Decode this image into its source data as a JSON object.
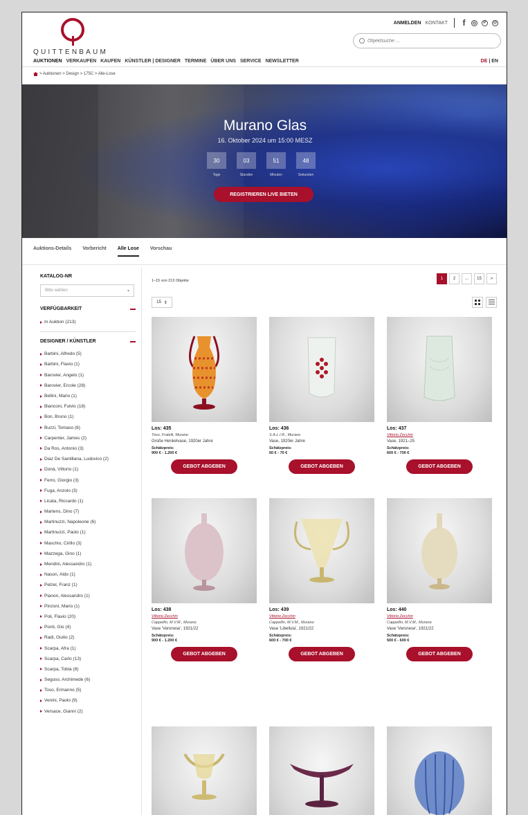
{
  "header": {
    "logo_text": "QUITTENBAUM",
    "anmelden": "ANMELDEN",
    "kontakt": "KONTAKT",
    "search_placeholder": "Objektsuche ...",
    "nav": [
      "AUKTIONEN",
      "VERKAUFEN",
      "KAUFEN",
      "KÜNSTLER | DESIGNER",
      "TERMINE",
      "ÜBER UNS",
      "SERVICE",
      "NEWSLETTER"
    ],
    "lang_de": "DE",
    "lang_sep": "|",
    "lang_en": "EN"
  },
  "breadcrumb": "> Auktionen > Design > 175C > Alle-Lose",
  "hero": {
    "title": "Murano Glas",
    "date": "16. Oktober 2024 um 15:00 MESZ",
    "countdown": [
      {
        "value": "30",
        "label": "Tage"
      },
      {
        "value": "03",
        "label": "Stunden"
      },
      {
        "value": "51",
        "label": "Minuten"
      },
      {
        "value": "48",
        "label": "Sekunden"
      }
    ],
    "register_label": "REGISTRIEREN LIVE BIETEN"
  },
  "tabs": [
    "Auktions-Details",
    "Vorbericht",
    "Alle Lose",
    "Vorschau"
  ],
  "sidebar": {
    "katalog_title": "KATALOG-NR",
    "katalog_placeholder": "Bitte wählen",
    "verf_title": "VERFÜGBARKEIT",
    "verf_items": [
      "In Auktion (213)"
    ],
    "designer_title": "DESIGNER / KÜNSTLER",
    "designers": [
      "Barbini, Alfredo (5)",
      "Barbini, Flavio (1)",
      "Barovier, Angelo (1)",
      "Barovier, Ercole (28)",
      "Bellini, Mario (1)",
      "Bianconi, Fulvio (18)",
      "Bon, Bruno (1)",
      "Buzzi, Tomaso (6)",
      "Carpenter, James (2)",
      "Da Ros, Antonio (3)",
      "Diaz De Santillana, Ludovico (2)",
      "Donà, Vittorio (1)",
      "Ferro, Giorgio (3)",
      "Fuga, Anzolo (3)",
      "Licata, Riccardo (1)",
      "Martens, Dino (7)",
      "Martinuzzi, Napoleone (6)",
      "Martinuzzi, Paolo (1)",
      "Maschio, Cirillo (3)",
      "Mazzega, Gino (1)",
      "Mendini, Alessandro (1)",
      "Nason, Aldo (1)",
      "Pelzel, Franz (1)",
      "Pianon, Alessandro (1)",
      "Pinzoni, Mario (1)",
      "Poli, Flavio (20)",
      "Ponti, Gio (4)",
      "Radi, Giulio (2)",
      "Scarpa, Afra (1)",
      "Scarpa, Carlo (13)",
      "Scarpa, Tobia (8)",
      "Seguso, Archimede (6)",
      "Toso, Ermanno (5)",
      "Venini, Paolo (9)",
      "Versace, Gianni (2)"
    ]
  },
  "listing": {
    "results": "1–15 von 213 Objekte",
    "pager": [
      "1",
      "2",
      "...",
      "15",
      "»"
    ],
    "per_page": "15",
    "per_page_caret": "⇕",
    "estimate_label": "Schätzpreis:",
    "bid_label": "GEBOT ABGEBEN",
    "lots": [
      {
        "lot": "Los: 435",
        "maker1": "Toso, Fratelli, Murano",
        "maker1_link": false,
        "maker2": "",
        "desc": "Große Henkelvase, 1920er Jahre",
        "price": "900 € - 1.200 €"
      },
      {
        "lot": "Los: 436",
        "maker1": "S.A.L.I.R., Murano",
        "maker1_link": false,
        "maker2": "",
        "desc": "Vase, 1920er Jahre",
        "price": "60 € - 70 €"
      },
      {
        "lot": "Los: 437",
        "maker1": "Vittorio Zecchin",
        "maker1_link": true,
        "maker2": "",
        "desc": "Vase, 1921–25",
        "price": "600 € - 700 €"
      },
      {
        "lot": "Los: 438",
        "maker1": "Vittorio Zecchin",
        "maker1_link": true,
        "maker2": "Cappellin, M.V.M., Murano",
        "desc": "Vase 'Veronese', 1921/22",
        "price": "900 € - 1.200 €"
      },
      {
        "lot": "Los: 439",
        "maker1": "Vittorio Zecchin",
        "maker1_link": true,
        "maker2": "Cappellin, M.V.M., Murano",
        "desc": "Vase 'Libellula', 1921/22",
        "price": "600 € - 700 €"
      },
      {
        "lot": "Los: 440",
        "maker1": "Vittorio Zecchin",
        "maker1_link": true,
        "maker2": "Cappellin, M.V.M., Murano",
        "desc": "Vase 'Veronese', 1921/22",
        "price": "500 € - 600 €"
      }
    ]
  },
  "colors": {
    "accent": "#a8102b"
  }
}
